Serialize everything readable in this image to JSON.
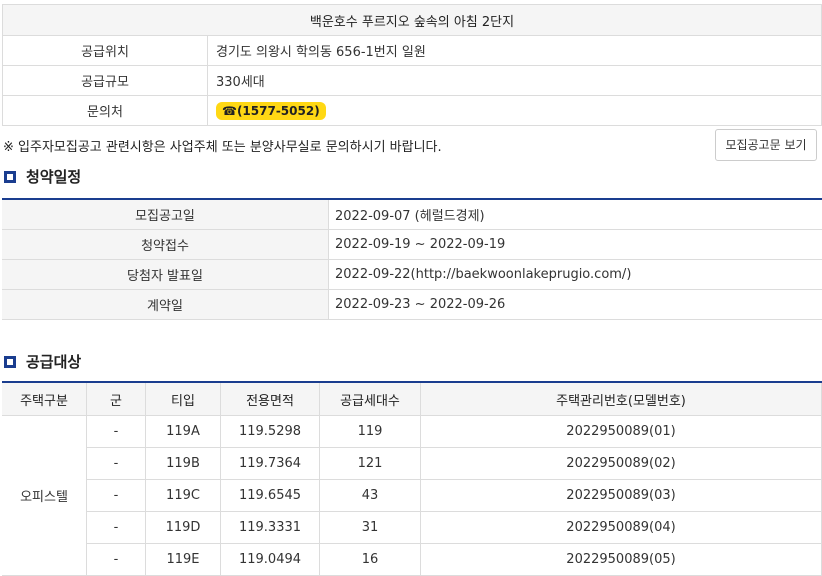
{
  "info": {
    "title": "백운호수 푸르지오 숲속의 아침 2단지",
    "rows": [
      {
        "label": "공급위치",
        "value": "경기도 의왕시 학의동 656-1번지 일원"
      },
      {
        "label": "공급규모",
        "value": "330세대"
      }
    ],
    "contact_label": "문의처",
    "contact_phone": "☎(1577-5052)"
  },
  "notice": {
    "text": "※ 입주자모집공고 관련시항은 사업주체 또는 분양사무실로 문의하시기 바랍니다.",
    "button_label": "모집공고문 보기"
  },
  "schedule": {
    "title": "청약일정",
    "rows": [
      {
        "label": "모집공고일",
        "value": "2022-09-07 (헤럴드경제)"
      },
      {
        "label": "청약접수",
        "value": "2022-09-19 ~ 2022-09-19"
      },
      {
        "label": "당첨자 발표일",
        "value": "2022-09-22(http://baekwoonlakeprugio.com/)"
      },
      {
        "label": "계약일",
        "value": "2022-09-23 ~ 2022-09-26"
      }
    ]
  },
  "supply": {
    "title": "공급대상",
    "headers": [
      "주택구분",
      "군",
      "티입",
      "전용면적",
      "공급세대수",
      "주택관리번호(모델번호)"
    ],
    "house_type": "오피스텔",
    "rows": [
      {
        "gun": "-",
        "type": "119A",
        "area": "119.5298",
        "units": "119",
        "code": "2022950089(01)"
      },
      {
        "gun": "-",
        "type": "119B",
        "area": "119.7364",
        "units": "121",
        "code": "2022950089(02)"
      },
      {
        "gun": "-",
        "type": "119C",
        "area": "119.6545",
        "units": "43",
        "code": "2022950089(03)"
      },
      {
        "gun": "-",
        "type": "119D",
        "area": "119.3331",
        "units": "31",
        "code": "2022950089(04)"
      },
      {
        "gun": "-",
        "type": "119E",
        "area": "119.0494",
        "units": "16",
        "code": "2022950089(05)"
      }
    ]
  },
  "colors": {
    "accent": "#1a3d8f",
    "badge": "#ffd814"
  }
}
